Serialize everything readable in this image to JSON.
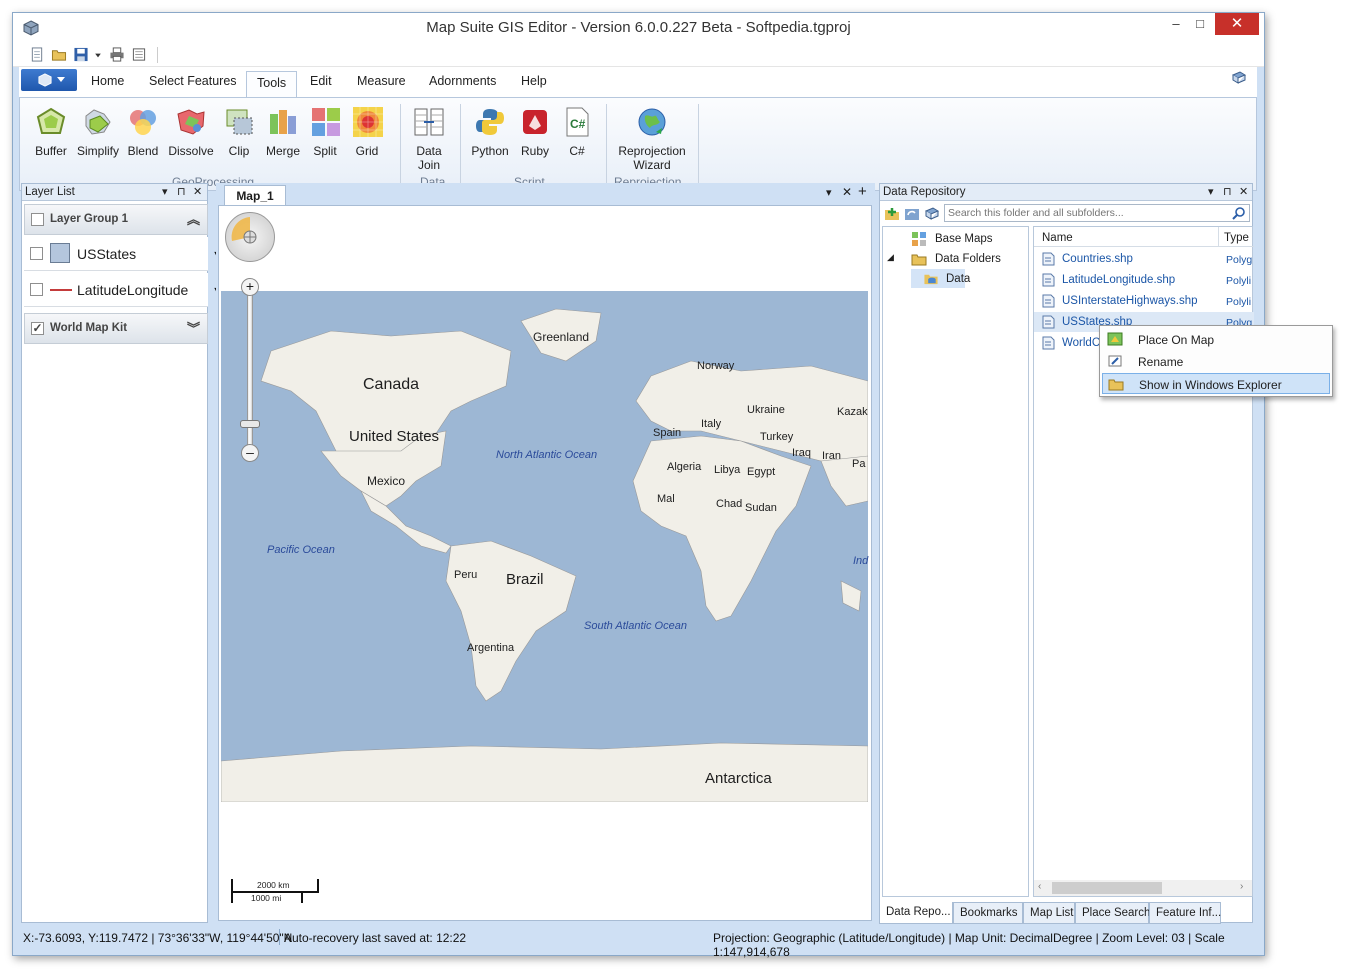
{
  "window": {
    "title": "Map Suite GIS Editor - Version 6.0.0.227 Beta - Softpedia.tgproj",
    "minimize": "–",
    "maximize": "□",
    "close": "✕"
  },
  "quick_access": {
    "icons": [
      "new-document-icon",
      "open-folder-icon",
      "save-icon",
      "dropdown-arrow-icon",
      "print-icon",
      "print-preview-icon"
    ]
  },
  "ribbon": {
    "tabs": [
      "Home",
      "Select Features",
      "Tools",
      "Edit",
      "Measure",
      "Adornments",
      "Help"
    ],
    "active_tab": "Tools",
    "buttons": {
      "buffer": "Buffer",
      "simplify": "Simplify",
      "blend": "Blend",
      "dissolve": "Dissolve",
      "clip": "Clip",
      "merge": "Merge",
      "split": "Split",
      "grid": "Grid",
      "data_join_1": "Data",
      "data_join_2": "Join",
      "python": "Python",
      "ruby": "Ruby",
      "csharp": "C#",
      "reproj_1": "Reprojection",
      "reproj_2": "Wizard"
    },
    "groups": {
      "geoprocessing": "GeoProcessing",
      "data": "Data",
      "script": "Script",
      "reprojection": "Reprojection"
    }
  },
  "layer_list": {
    "title": "Layer List",
    "group1": "Layer Group 1",
    "layer1": "USStates",
    "layer2": "LatitudeLongitude",
    "group2": "World Map Kit"
  },
  "map": {
    "tab_label": "Map_1",
    "labels": {
      "greenland": "Greenland",
      "canada": "Canada",
      "united_states": "United States",
      "mexico": "Mexico",
      "norway": "Norway",
      "ukraine": "Ukraine",
      "kazak": "Kazak",
      "spain": "Spain",
      "italy": "Italy",
      "turkey": "Turkey",
      "iraq": "Iraq",
      "iran": "Iran",
      "pa": "Pa",
      "algeria": "Algeria",
      "libya": "Libya",
      "egypt": "Egypt",
      "mali": "Mal",
      "chad": "Chad",
      "sudan": "Sudan",
      "north_atlantic": "North Atlantic Ocean",
      "pacific": "Pacific Ocean",
      "ind": "Ind",
      "peru": "Peru",
      "brazil": "Brazil",
      "south_atlantic": "South Atlantic Ocean",
      "argentina": "Argentina",
      "antarctica": "Antarctica"
    },
    "scale_km": "2000 km",
    "scale_mi": "1000 mi"
  },
  "repository": {
    "title": "Data Repository",
    "search_placeholder": "Search this folder and all subfolders...",
    "tree": [
      "Base Maps",
      "Data Folders",
      "Data"
    ],
    "columns": [
      "Name",
      "Type"
    ],
    "files": [
      {
        "name": "Countries.shp",
        "type": "Polyg"
      },
      {
        "name": "LatitudeLongitude.shp",
        "type": "Polyli"
      },
      {
        "name": "USInterstateHighways.shp",
        "type": "Polyli"
      },
      {
        "name": "USStates.shp",
        "type": "Polyg"
      },
      {
        "name": "WorldC",
        "type": ""
      }
    ]
  },
  "context_menu": {
    "items": [
      "Place On Map",
      "Rename",
      "Show in Windows Explorer"
    ],
    "highlighted": "Show in Windows Explorer"
  },
  "bottom_tabs": [
    "Data Repo...",
    "Bookmarks",
    "Map List",
    "Place Search",
    "Feature Inf..."
  ],
  "status": {
    "coords": "X:-73.6093, Y:119.7472 | 73°36'33\"W, 119°44'50\"N",
    "autosave": "Auto-recovery last saved at: 12:22",
    "right": "Projection: Geographic (Latitude/Longitude) | Map Unit: DecimalDegree | Zoom Level: 03 | Scale 1:147,914,678"
  },
  "colors": {
    "ocean": "#9db7d4",
    "land": "#f1efe8",
    "accent": "#2b5ea8",
    "window_bg": "#cfe0f4"
  }
}
